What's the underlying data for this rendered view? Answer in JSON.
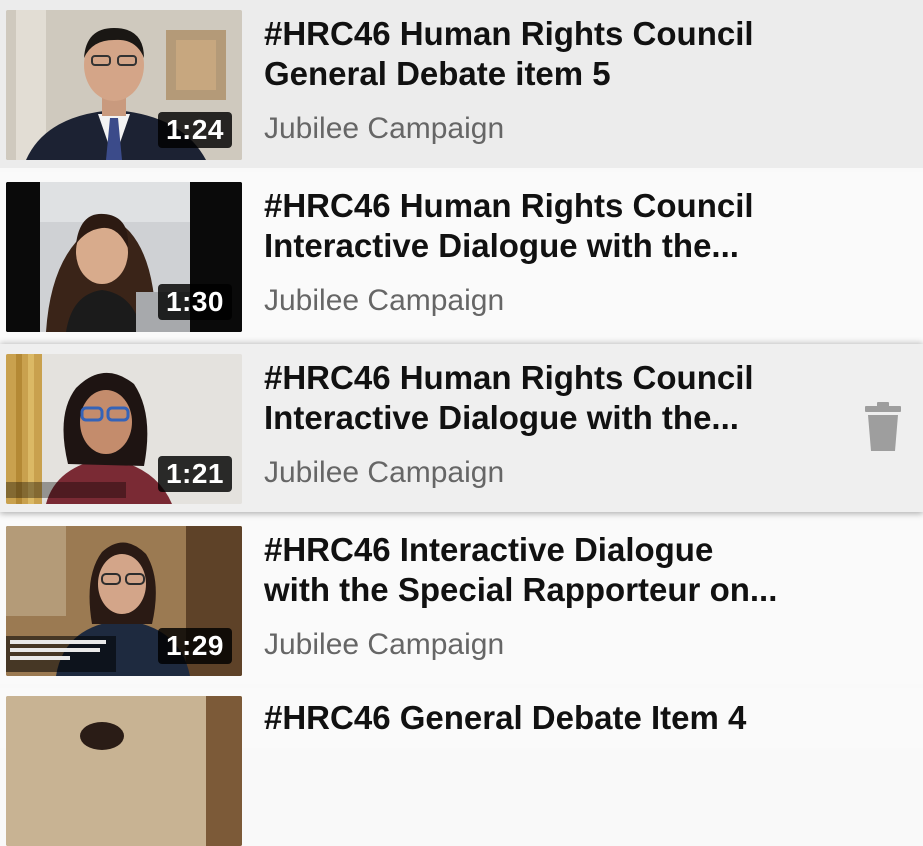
{
  "videos": [
    {
      "title_line1": "#HRC46 Human Rights Council",
      "title_line2": "General Debate item 5",
      "channel": "Jubilee Campaign",
      "duration": "1:24"
    },
    {
      "title_line1": "#HRC46 Human Rights Council",
      "title_line2": "Interactive Dialogue with the...",
      "channel": "Jubilee Campaign",
      "duration": "1:30"
    },
    {
      "title_line1": "#HRC46 Human Rights Council",
      "title_line2": "Interactive Dialogue with the...",
      "channel": "Jubilee Campaign",
      "duration": "1:21",
      "action_icon": "trash-icon"
    },
    {
      "title_line1": "#HRC46 Interactive Dialogue",
      "title_line2": "with the Special Rapporteur on...",
      "channel": "Jubilee Campaign",
      "duration": "1:29"
    },
    {
      "title_line1": "#HRC46 General Debate Item 4",
      "title_line2": "",
      "channel": "",
      "duration": ""
    }
  ],
  "colors": {
    "background": "#f9f9f9",
    "title": "#111111",
    "channel": "#666666",
    "duration_bg": "#000000",
    "trash": "#9e9e9e"
  }
}
